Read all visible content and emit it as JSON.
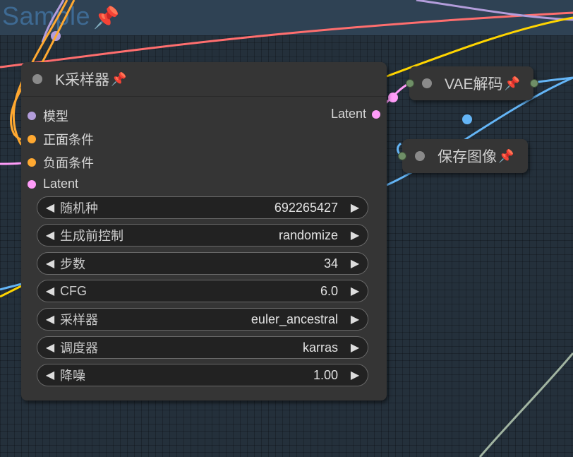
{
  "group": {
    "title": "Sample",
    "pin_icon": "📌"
  },
  "ksampler": {
    "title": "K采样器",
    "pin_icon": "📌",
    "inputs": [
      {
        "label": "模型",
        "color": "#b39ddb"
      },
      {
        "label": "正面条件",
        "color": "#ffa931"
      },
      {
        "label": "负面条件",
        "color": "#ffa931"
      },
      {
        "label": "Latent",
        "color": "#ff9cf9"
      }
    ],
    "output": {
      "label": "Latent",
      "color": "#ff9cf9"
    },
    "widgets": [
      {
        "label": "随机种",
        "value": "692265427"
      },
      {
        "label": "生成前控制",
        "value": "randomize"
      },
      {
        "label": "步数",
        "value": "34"
      },
      {
        "label": "CFG",
        "value": "6.0"
      },
      {
        "label": "采样器",
        "value": "euler_ancestral"
      },
      {
        "label": "调度器",
        "value": "karras"
      },
      {
        "label": "降噪",
        "value": "1.00"
      }
    ],
    "arrow_left": "◀",
    "arrow_right": "▶"
  },
  "vae_decode": {
    "title": "VAE解码",
    "pin_icon": "📌"
  },
  "save_image": {
    "title": "保存图像",
    "pin_icon": "📌"
  },
  "colors": {
    "canvas": "#24303b",
    "group_header": "#2f4254",
    "node_body": "#353535",
    "link_model": "#b39ddb",
    "link_conditioning": "#ffa931",
    "link_latent": "#ff9cf9",
    "link_image": "#64b5f6",
    "link_vae": "#ff6e6e",
    "link_clip": "#ffd500",
    "link_other": "#a1b4a1"
  }
}
